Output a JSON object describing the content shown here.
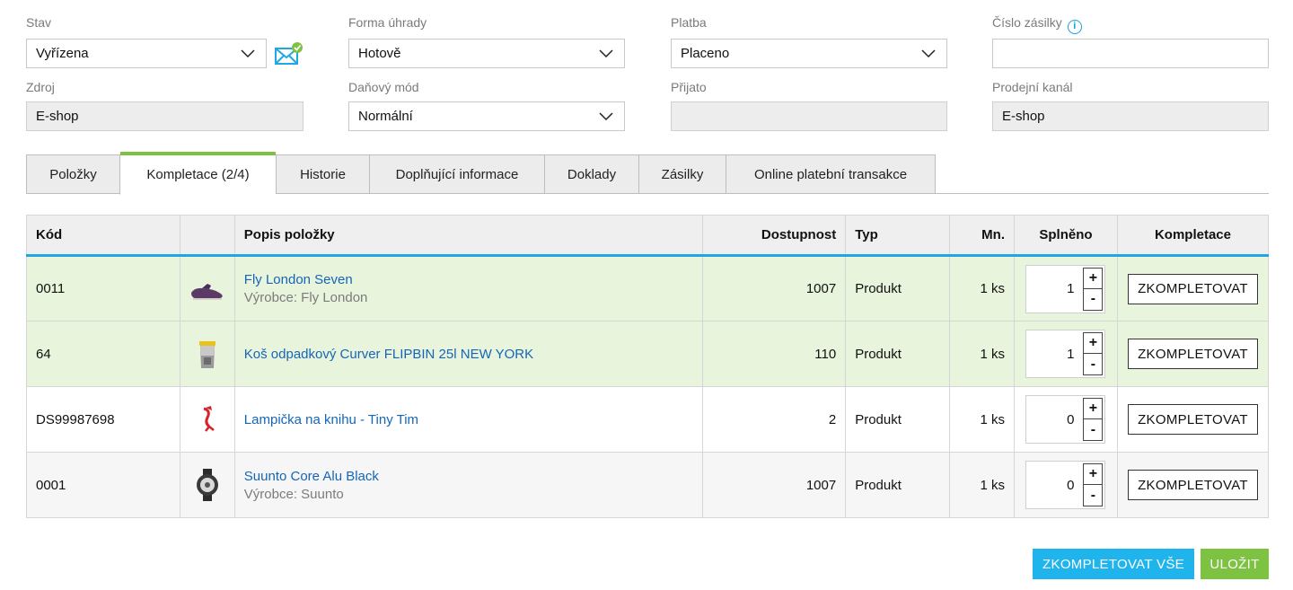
{
  "form": {
    "stav": {
      "label": "Stav",
      "value": "Vyřízena"
    },
    "forma_uhrady": {
      "label": "Forma úhrady",
      "value": "Hotově"
    },
    "platba": {
      "label": "Platba",
      "value": "Placeno"
    },
    "cislo_zasilky": {
      "label": "Číslo zásilky",
      "value": ""
    },
    "zdroj": {
      "label": "Zdroj",
      "value": "E-shop"
    },
    "danovy_mod": {
      "label": "Daňový mód",
      "value": "Normální"
    },
    "prijato": {
      "label": "Přijato",
      "value": ""
    },
    "prodejni_kanal": {
      "label": "Prodejní kanál",
      "value": "E-shop"
    },
    "info_icon": "info-icon",
    "mail_icon": "mail-check-icon"
  },
  "tabs": [
    {
      "label": "Položky",
      "active": false
    },
    {
      "label": "Kompletace (2/4)",
      "active": true
    },
    {
      "label": "Historie",
      "active": false
    },
    {
      "label": "Doplňující informace",
      "active": false
    },
    {
      "label": "Doklady",
      "active": false
    },
    {
      "label": "Zásilky",
      "active": false
    },
    {
      "label": "Online platební transakce",
      "active": false
    }
  ],
  "table": {
    "columns": [
      "Kód",
      "",
      "Popis položky",
      "Dostupnost",
      "Typ",
      "Mn.",
      "Splněno",
      "Kompletace"
    ],
    "rows": [
      {
        "code": "0011",
        "thumb": "shoe",
        "name": "Fly London Seven",
        "maker": "Výrobce: Fly London",
        "availability": "1007",
        "type": "Produkt",
        "qty": "1 ks",
        "done": "1",
        "action": "ZKOMPLETOVAT",
        "state": "done"
      },
      {
        "code": "64",
        "thumb": "bin",
        "name": "Koš odpadkový Curver FLIPBIN 25l NEW YORK",
        "maker": "",
        "availability": "110",
        "type": "Produkt",
        "qty": "1 ks",
        "done": "1",
        "action": "ZKOMPLETOVAT",
        "state": "done"
      },
      {
        "code": "DS99987698",
        "thumb": "lamp",
        "name": "Lampička na knihu - Tiny Tim",
        "maker": "",
        "availability": "2",
        "type": "Produkt",
        "qty": "1 ks",
        "done": "0",
        "action": "ZKOMPLETOVAT",
        "state": "open"
      },
      {
        "code": "0001",
        "thumb": "watch",
        "name": "Suunto Core Alu Black",
        "maker": "Výrobce: Suunto",
        "availability": "1007",
        "type": "Produkt",
        "qty": "1 ks",
        "done": "0",
        "action": "ZKOMPLETOVAT",
        "state": "alt"
      }
    ],
    "stepper_plus": "+",
    "stepper_minus": "-"
  },
  "actions": {
    "complete_all": "ZKOMPLETOVAT VŠE",
    "save": "ULOŽIT"
  },
  "colors": {
    "accent_blue": "#1fb4ec",
    "accent_green": "#7ec242",
    "link": "#1566b8",
    "done_row": "#e8f4dc"
  }
}
